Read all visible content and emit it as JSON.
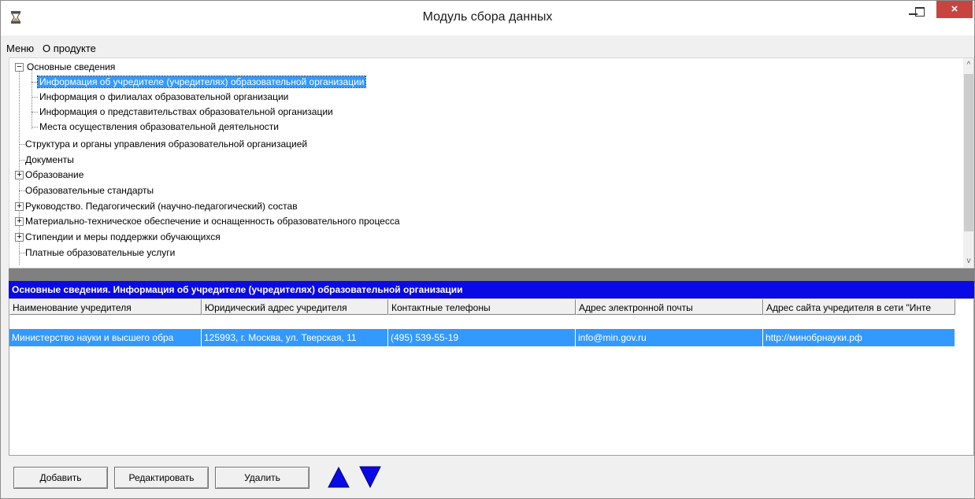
{
  "window": {
    "title": "Модуль сбора данных",
    "close_glyph": "×"
  },
  "menu": {
    "items": [
      "Меню",
      "О продукте"
    ]
  },
  "tree": {
    "nodes": [
      {
        "label": "Основные сведения",
        "expander": "−",
        "level": 0
      },
      {
        "label": "Информация об учредителе (учредителях) образовательной организации",
        "expander": "",
        "level": 1,
        "selected": true
      },
      {
        "label": "Информация о филиалах образовательной организации",
        "expander": "",
        "level": 1
      },
      {
        "label": "Информация о представительствах образовательной организации",
        "expander": "",
        "level": 1
      },
      {
        "label": "Места осуществления образовательной деятельности",
        "expander": "",
        "level": 1
      },
      {
        "label": "Структура и органы управления образовательной организацией",
        "expander": "",
        "level": 0
      },
      {
        "label": "Документы",
        "expander": "",
        "level": 0
      },
      {
        "label": "Образование",
        "expander": "+",
        "level": 0
      },
      {
        "label": "Образовательные стандарты",
        "expander": "",
        "level": 0
      },
      {
        "label": "Руководство. Педагогический (научно-педагогический) состав",
        "expander": "+",
        "level": 0
      },
      {
        "label": "Материально-техническое обеспечение и оснащенность образовательного процесса",
        "expander": "+",
        "level": 0
      },
      {
        "label": "Стипендии и меры поддержки обучающихся",
        "expander": "+",
        "level": 0
      },
      {
        "label": "Платные образовательные услуги",
        "expander": "",
        "level": 0
      }
    ],
    "scroll_up_glyph": "^",
    "scroll_down_glyph": "v"
  },
  "section": {
    "title": "Основные сведения. Информация об учредителе (учредителях) образовательной организации"
  },
  "grid": {
    "columns": [
      "Наименование учредителя",
      "Юридический адрес учредителя",
      "Контактные телефоны",
      "Адрес электронной почты",
      "Адрес сайта учредителя в сети \"Инте"
    ],
    "rows": [
      [
        "Министерство науки и высшего обра",
        "125993, г. Москва, ул. Тверская, 11",
        "(495) 539-55-19",
        "info@min.gov.ru",
        "http://минобрнауки.рф"
      ]
    ]
  },
  "toolbar": {
    "add_label": "Добавить",
    "edit_label": "Редактировать",
    "delete_label": "Удалить"
  },
  "colors": {
    "accent_blue": "#0a0ae6",
    "selection_blue": "#3399ff",
    "close_red": "#c7443f"
  }
}
